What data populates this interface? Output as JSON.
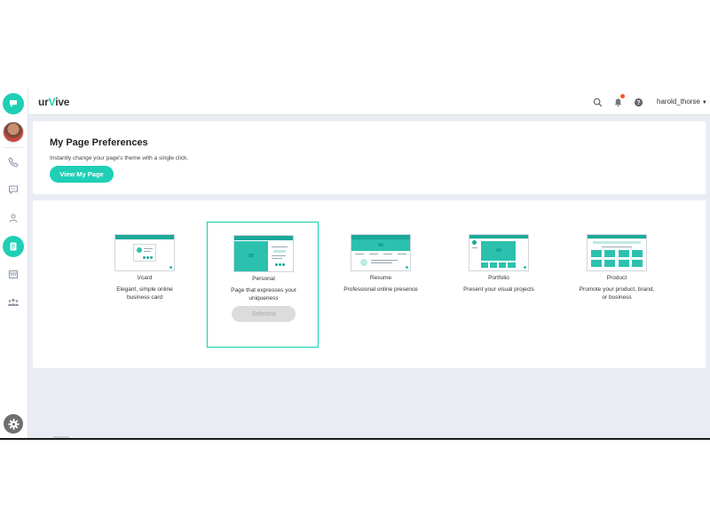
{
  "header": {
    "brand_prefix": "ur",
    "brand_mark": "V",
    "brand_suffix": "ive",
    "username": "harold_thorse",
    "icons": [
      "search-icon",
      "bell-icon",
      "help-icon",
      "chevron-down-icon"
    ]
  },
  "sidebar": {
    "items": [
      {
        "name": "phone-icon"
      },
      {
        "name": "chat-icon"
      },
      {
        "name": "contacts-icon"
      },
      {
        "name": "page-icon",
        "active": true
      },
      {
        "name": "calendar-icon"
      },
      {
        "name": "team-icon"
      }
    ],
    "settings_icon": "gear-icon"
  },
  "preferences": {
    "title": "My Page Preferences",
    "subtitle": "Instantly change your page's theme with a single click.",
    "view_button": "View My Page"
  },
  "themes": [
    {
      "name": "Vcard",
      "desc": "Elegant, simple online business card",
      "selected": false
    },
    {
      "name": "Personal",
      "desc": "Page that expresses your uniqueness",
      "selected": true,
      "button": "Selected"
    },
    {
      "name": "Resume",
      "desc": "Professional online presence",
      "selected": false
    },
    {
      "name": "Portfolio",
      "desc": "Present your visual projects",
      "selected": false
    },
    {
      "name": "Product",
      "desc": "Promote your product, brand, or business",
      "selected": false
    }
  ],
  "colors": {
    "accent": "#1ecfb6",
    "accent_dark": "#1ba898",
    "notification": "#f05a28",
    "background": "#e9edf3"
  }
}
